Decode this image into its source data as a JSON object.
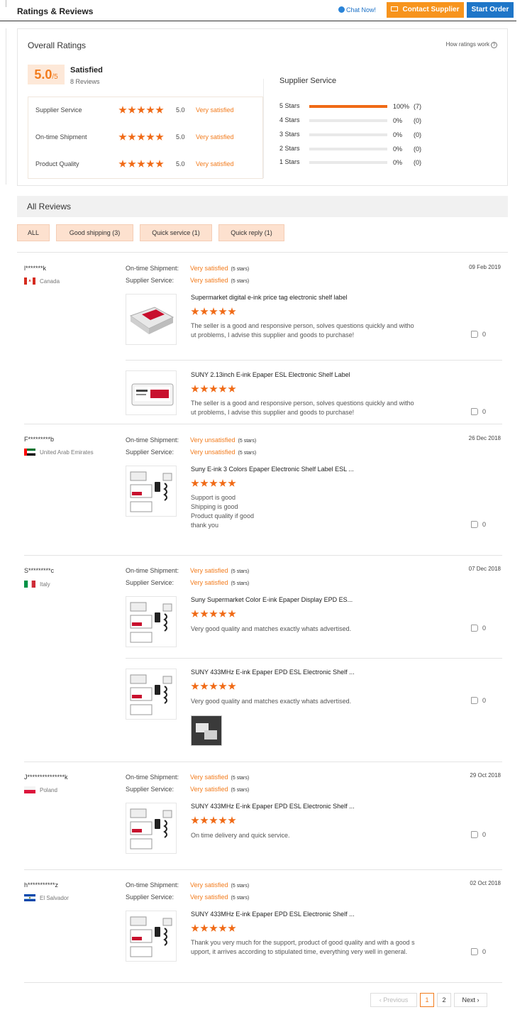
{
  "header": {
    "title": "Ratings & Reviews",
    "chat_now": "Chat Now!",
    "contact_supplier": "Contact Supplier",
    "start_order": "Start Order"
  },
  "overall": {
    "title": "Overall Ratings",
    "how_link": "How ratings work",
    "score": "5.0",
    "score_suffix": "/5",
    "satisfaction": "Satisfied",
    "review_count": "8 Reviews",
    "categories": [
      {
        "label": "Supplier Service",
        "value": "5.0",
        "text": "Very satisfied",
        "stars": 5
      },
      {
        "label": "On-time Shipment",
        "value": "5.0",
        "text": "Very satisfied",
        "stars": 5
      },
      {
        "label": "Product Quality",
        "value": "5.0",
        "text": "Very satisfied",
        "stars": 5
      }
    ],
    "breakdown_title": "Supplier Service",
    "breakdown": [
      {
        "label": "5 Stars",
        "pct": "100%",
        "count": "(7)",
        "fraction": 1.0
      },
      {
        "label": "4 Stars",
        "pct": "0%",
        "count": "(0)",
        "fraction": 0
      },
      {
        "label": "3 Stars",
        "pct": "0%",
        "count": "(0)",
        "fraction": 0
      },
      {
        "label": "2 Stars",
        "pct": "0%",
        "count": "(0)",
        "fraction": 0
      },
      {
        "label": "1 Stars",
        "pct": "0%",
        "count": "(0)",
        "fraction": 0
      }
    ]
  },
  "all_reviews": {
    "title": "All Reviews",
    "filters": [
      "ALL",
      "Good shipping (3)",
      "Quick service (1)",
      "Quick reply (1)"
    ]
  },
  "labels": {
    "ontime": "On-time Shipment:",
    "supplier": "Supplier Service:"
  },
  "reviews": [
    {
      "user": "l*******k",
      "country": "Canada",
      "date": "09 Feb 2019",
      "ontime": "Very satisfied",
      "ontime_stars": "(5 stars)",
      "supplier": "Very satisfied",
      "supplier_stars": "(5 stars)",
      "items": [
        {
          "name": "Supermarket digital e-ink price tag electronic shelf label",
          "text": "The seller is a good and responsive person, solves questions quickly and witho\nut problems, I advise this supplier and goods to purchase!",
          "likes": "0"
        },
        {
          "name": "SUNY 2.13inch E-ink Epaper ESL Electronic Shelf Label",
          "text": "The seller is a good and responsive person, solves questions quickly and witho\nut problems, I advise this supplier and goods to purchase!",
          "likes": "0"
        }
      ]
    },
    {
      "user": "F*********b",
      "country": "United Arab Emirates",
      "date": "26 Dec 2018",
      "ontime": "Very unsatisfied",
      "ontime_stars": "(5 stars)",
      "supplier": "Very unsatisfied",
      "supplier_stars": "(5 stars)",
      "items": [
        {
          "name": "Suny E-ink 3 Colors Epaper Electronic Shelf Label ESL ...",
          "text": "Support is good\nShipping is good\nProduct quality if good\nthank you",
          "likes": "0"
        }
      ]
    },
    {
      "user": "S*********c",
      "country": "Italy",
      "date": "07 Dec 2018",
      "ontime": "Very satisfied",
      "ontime_stars": "(5 stars)",
      "supplier": "Very satisfied",
      "supplier_stars": "(5 stars)",
      "items": [
        {
          "name": "Suny Supermarket Color E-ink Epaper Display EPD ES...",
          "text": "Very good quality and matches exactly whats advertised.",
          "likes": "0"
        },
        {
          "name": "SUNY 433MHz E-ink Epaper EPD ESL Electronic Shelf ...",
          "text": "Very good quality and matches exactly whats advertised.",
          "likes": "0"
        }
      ]
    },
    {
      "user": "J***************k",
      "country": "Poland",
      "date": "29 Oct 2018",
      "ontime": "Very satisfied",
      "ontime_stars": "(5 stars)",
      "supplier": "Very satisfied",
      "supplier_stars": "(5 stars)",
      "items": [
        {
          "name": "SUNY 433MHz E-ink Epaper EPD ESL Electronic Shelf ...",
          "text": "On time delivery and quick service.",
          "likes": "0"
        }
      ]
    },
    {
      "user": "h***********z",
      "country": "El Salvador",
      "date": "02 Oct 2018",
      "ontime": "Very satisfied",
      "ontime_stars": "(5 stars)",
      "supplier": "Very satisfied",
      "supplier_stars": "(5 stars)",
      "items": [
        {
          "name": "SUNY 433MHz E-ink Epaper EPD ESL Electronic Shelf ...",
          "text": "Thank you very much for the support, product of good quality and with a good s\nupport, it arrives according to stipulated time, everything very well in general.",
          "likes": "0"
        }
      ]
    }
  ],
  "pagination": {
    "previous": "Previous",
    "pages": [
      "1",
      "2"
    ],
    "current": "1",
    "next": "Next"
  },
  "colors": {
    "accent": "#f27b1c",
    "star": "#f06a16",
    "primary": "#1f76c8",
    "contact": "#f7941d"
  }
}
